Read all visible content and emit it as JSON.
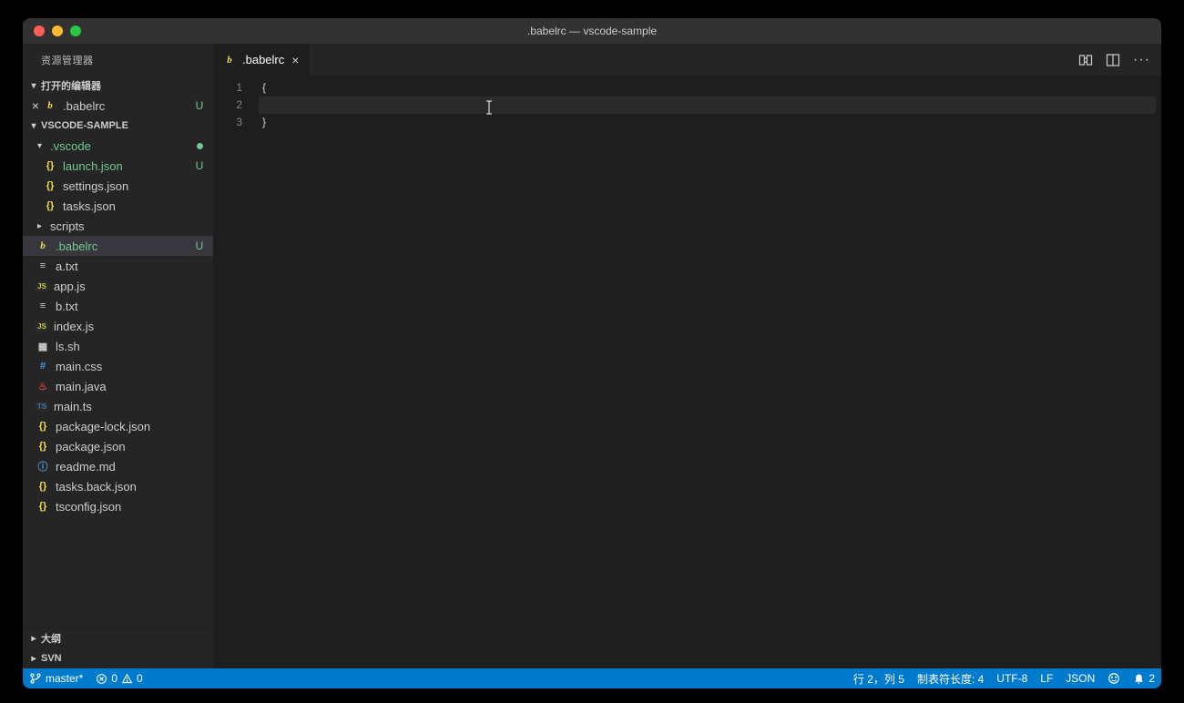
{
  "window": {
    "title": ".babelrc — vscode-sample"
  },
  "explorer": {
    "title": "资源管理器",
    "open_editors_label": "打开的编辑器",
    "project_label": "VSCODE-SAMPLE",
    "outline_label": "大纲",
    "svn_label": "SVN"
  },
  "open_editors": [
    {
      "name": ".babelrc",
      "status": "U"
    }
  ],
  "tree": {
    "vscode_folder": ".vscode",
    "vscode_children": [
      {
        "name": "launch.json",
        "status": "U",
        "green": true
      },
      {
        "name": "settings.json"
      },
      {
        "name": "tasks.json"
      }
    ],
    "scripts_folder": "scripts",
    "files": [
      {
        "name": ".babelrc",
        "icon": "babel",
        "status": "U",
        "selected": true
      },
      {
        "name": "a.txt",
        "icon": "txt"
      },
      {
        "name": "app.js",
        "icon": "js"
      },
      {
        "name": "b.txt",
        "icon": "txt"
      },
      {
        "name": "index.js",
        "icon": "js"
      },
      {
        "name": "ls.sh",
        "icon": "sh"
      },
      {
        "name": "main.css",
        "icon": "css"
      },
      {
        "name": "main.java",
        "icon": "java"
      },
      {
        "name": "main.ts",
        "icon": "ts"
      },
      {
        "name": "package-lock.json",
        "icon": "json"
      },
      {
        "name": "package.json",
        "icon": "json"
      },
      {
        "name": "readme.md",
        "icon": "md"
      },
      {
        "name": "tasks.back.json",
        "icon": "json"
      },
      {
        "name": "tsconfig.json",
        "icon": "json"
      }
    ]
  },
  "tab": {
    "name": ".babelrc"
  },
  "code": {
    "lines": [
      "{",
      "    ",
      "}"
    ],
    "line_numbers": [
      "1",
      "2",
      "3"
    ]
  },
  "statusbar": {
    "branch": "master*",
    "errors": "0",
    "warnings": "0",
    "position": "行 2，列 5",
    "tabsize": "制表符长度: 4",
    "encoding": "UTF-8",
    "eol": "LF",
    "language": "JSON",
    "notifications": "2"
  }
}
